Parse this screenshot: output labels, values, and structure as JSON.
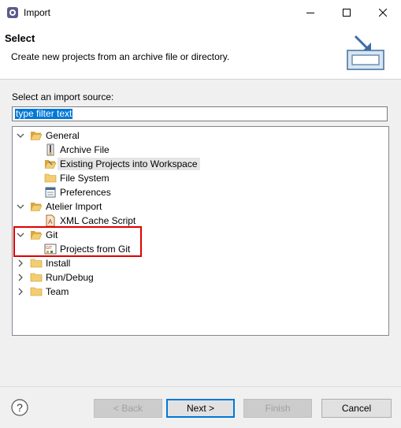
{
  "window": {
    "title": "Import"
  },
  "header": {
    "title": "Select",
    "description": "Create new projects from an archive file or directory."
  },
  "source": {
    "label": "Select an import source:",
    "filter_value": "type filter text"
  },
  "tree": {
    "general": {
      "label": "General",
      "children": [
        "Archive File",
        "Existing Projects into Workspace",
        "File System",
        "Preferences"
      ]
    },
    "atelier": {
      "label": "Atelier Import",
      "children": [
        "XML Cache Script"
      ]
    },
    "git": {
      "label": "Git",
      "children": [
        "Projects from Git"
      ],
      "git_badge": "GIT"
    },
    "install": {
      "label": "Install"
    },
    "rundebug": {
      "label": "Run/Debug"
    },
    "team": {
      "label": "Team"
    }
  },
  "buttons": {
    "back": "< Back",
    "next": "Next >",
    "finish": "Finish",
    "cancel": "Cancel"
  },
  "colors": {
    "selection": "#0078d7",
    "highlight": "#e00000",
    "folder": "#e8b84a"
  }
}
